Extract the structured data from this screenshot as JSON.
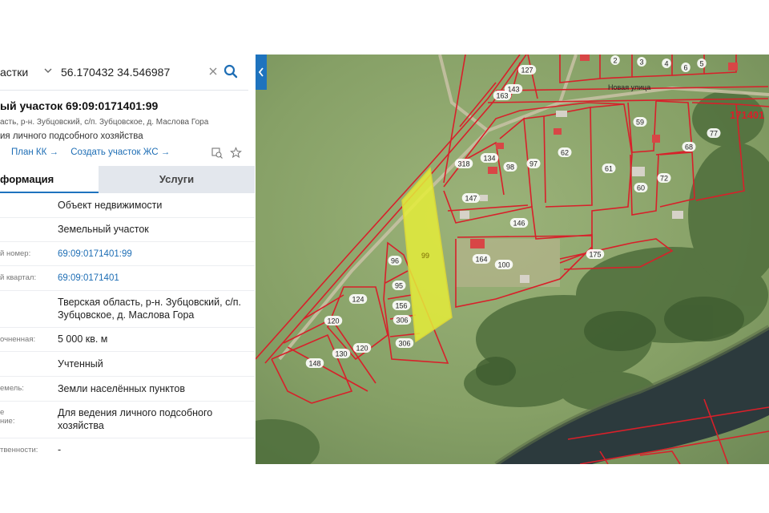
{
  "search": {
    "category": "астки",
    "value": "56.170432 34.546987"
  },
  "parcel": {
    "title": "ый участок 69:09:0171401:99",
    "address": "асть, р-н. Зубцовский, с/п. Зубцовское, д. Маслова Гора",
    "purpose": "ия личного подсобного хозяйства",
    "links": [
      "План КК →",
      "Создать участок ЖС →"
    ]
  },
  "tabs": {
    "info": "формация",
    "services": "Услуги"
  },
  "rows": [
    {
      "label": "",
      "value": "Объект недвижимости"
    },
    {
      "label": "",
      "value": "Земельный участок"
    },
    {
      "label": "й номер:",
      "value": "69:09:0171401:99"
    },
    {
      "label": "й квартал:",
      "value": "69:09:0171401"
    },
    {
      "label": "",
      "value": "Тверская область, р-н. Зубцовский, с/п. Зубцовское, д. Маслова Гора"
    },
    {
      "label": "очненная:",
      "value": "5 000 кв. м"
    },
    {
      "label": "",
      "value": "Учтенный"
    },
    {
      "label": "емель:",
      "value": "Земли населённых пунктов"
    },
    {
      "label": "е\nние:",
      "value": "Для ведения личного подсобного хозяйства"
    },
    {
      "label": "твенности:",
      "value": "-"
    }
  ],
  "map": {
    "street": "Новая улица",
    "quarter": "171401",
    "selected_parcel": "99",
    "parcel_labels": [
      "2",
      "3",
      "4",
      "6",
      "5",
      "127",
      "143",
      "163",
      "59",
      "68",
      "77",
      "134",
      "318",
      "98",
      "97",
      "62",
      "61",
      "60",
      "72",
      "147",
      "146",
      "96",
      "95",
      "164",
      "100",
      "175",
      "124",
      "156",
      "306",
      "306",
      "120",
      "120",
      "130",
      "148"
    ],
    "colors": {
      "boundary": "#d8202a",
      "selected_fill": "#e4ec3a",
      "accent": "#1e73be",
      "river": "#2a3a3e",
      "field": "#8aa46a"
    }
  },
  "icons": [
    "chevron-down-icon",
    "clear-icon",
    "search-icon",
    "collapse-arrow-icon",
    "layers-icon",
    "star-icon"
  ]
}
